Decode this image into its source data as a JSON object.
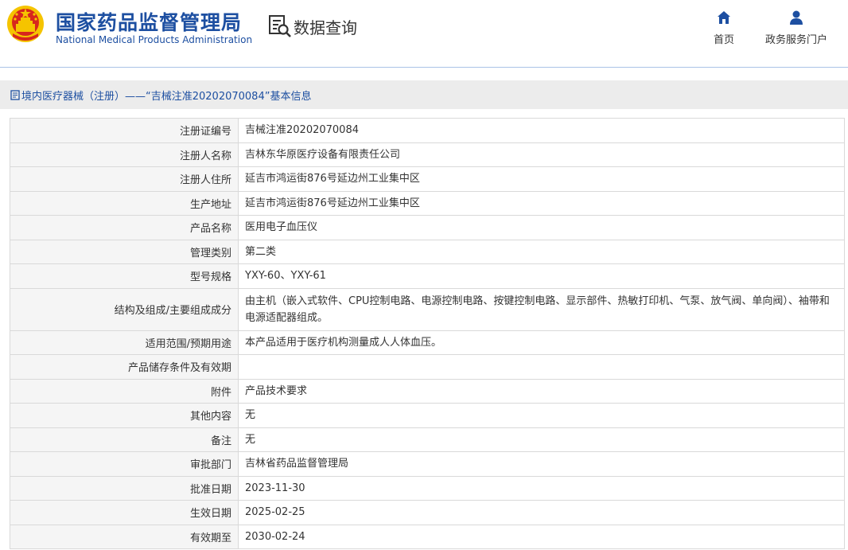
{
  "header": {
    "org_name_cn": "国家药品监督管理局",
    "org_name_en": "National Medical Products Administration",
    "data_query_label": "数据查询",
    "nav": [
      {
        "label": "首页",
        "icon": "home-icon"
      },
      {
        "label": "政务服务门户",
        "icon": "user-icon"
      }
    ]
  },
  "breadcrumb": {
    "text": "境内医疗器械（注册）——“吉械注准20202070084”基本信息",
    "icon": "document-icon"
  },
  "record": [
    {
      "label": "注册证编号",
      "value": "吉械注准20202070084"
    },
    {
      "label": "注册人名称",
      "value": "吉林东华原医疗设备有限责任公司"
    },
    {
      "label": "注册人住所",
      "value": "延吉市鸿运街876号延边州工业集中区"
    },
    {
      "label": "生产地址",
      "value": "延吉市鸿运街876号延边州工业集中区"
    },
    {
      "label": "产品名称",
      "value": "医用电子血压仪"
    },
    {
      "label": "管理类别",
      "value": "第二类"
    },
    {
      "label": "型号规格",
      "value": "YXY-60、YXY-61"
    },
    {
      "label": "结构及组成/主要组成成分",
      "value": "由主机（嵌入式软件、CPU控制电路、电源控制电路、按键控制电路、显示部件、热敏打印机、气泵、放气阀、单向阀）、袖带和电源适配器组成。"
    },
    {
      "label": "适用范围/预期用途",
      "value": "本产品适用于医疗机构测量成人人体血压。"
    },
    {
      "label": "产品储存条件及有效期",
      "value": ""
    },
    {
      "label": "附件",
      "value": "产品技术要求"
    },
    {
      "label": "其他内容",
      "value": "无"
    },
    {
      "label": "备注",
      "value": "无"
    },
    {
      "label": "审批部门",
      "value": "吉林省药品监督管理局"
    },
    {
      "label": "批准日期",
      "value": "2023-11-30"
    },
    {
      "label": "生效日期",
      "value": "2025-02-25"
    },
    {
      "label": "有效期至",
      "value": "2030-02-24"
    }
  ],
  "colors": {
    "brand_blue": "#1d4fa1",
    "emblem_red": "#d7261d",
    "emblem_gold": "#f5c400",
    "label_bg": "#f5f5f5",
    "breadcrumb_bg": "#ececec"
  }
}
